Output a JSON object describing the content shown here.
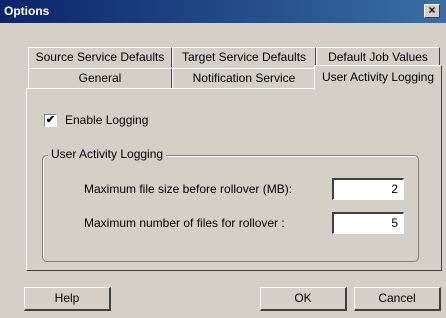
{
  "window": {
    "title": "Options",
    "close_glyph": "×"
  },
  "tabs": {
    "row1": [
      "Source Service Defaults",
      "Target Service Defaults",
      "Default Job Values"
    ],
    "row2": [
      "General",
      "Notification Service",
      "User Activity Logging"
    ],
    "active": "User Activity Logging"
  },
  "logging": {
    "enable_label": "Enable Logging",
    "enabled": true,
    "check_glyph": "✔",
    "group_title": "User Activity Logging",
    "max_size_label": "Maximum file size before rollover (MB):",
    "max_size_value": "2",
    "max_files_label": "Maximum number of files for rollover :",
    "max_files_value": "5"
  },
  "buttons": {
    "help": "Help",
    "ok": "OK",
    "cancel": "Cancel"
  }
}
